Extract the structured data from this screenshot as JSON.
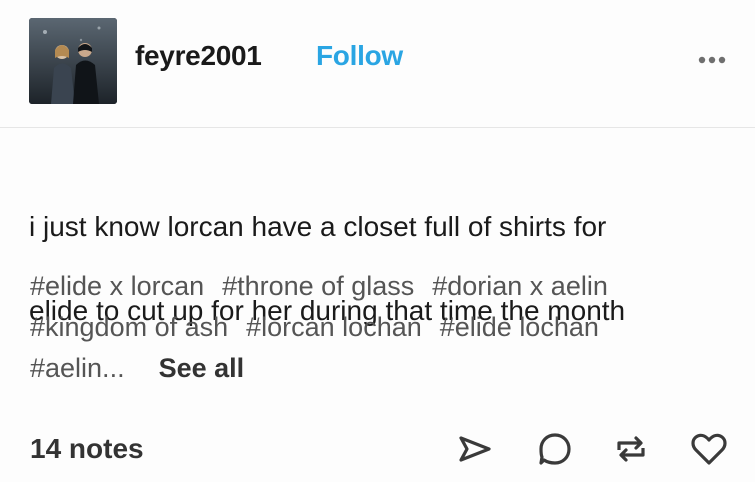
{
  "post": {
    "username": "feyre2001",
    "follow_label": "Follow",
    "more_icon": "more-dots-icon",
    "body_lines": [
      "i just know lorcan  have a closet full of shirts for",
      "elide to cut up for her during that time the month"
    ],
    "tags": [
      "#elide x lorcan",
      "#throne of glass",
      "#dorian x aelin",
      "#kingdom of ash",
      "#lorcan lochan",
      "#elide lochan",
      "#aelin..."
    ],
    "see_all_label": "See all"
  },
  "footer": {
    "notes_label": "14 notes",
    "actions": [
      "share-icon",
      "reply-icon",
      "reblog-icon",
      "like-icon"
    ]
  },
  "colors": {
    "follow": "#2aa5e3",
    "text": "#1a1a1a",
    "tag": "#555555"
  }
}
